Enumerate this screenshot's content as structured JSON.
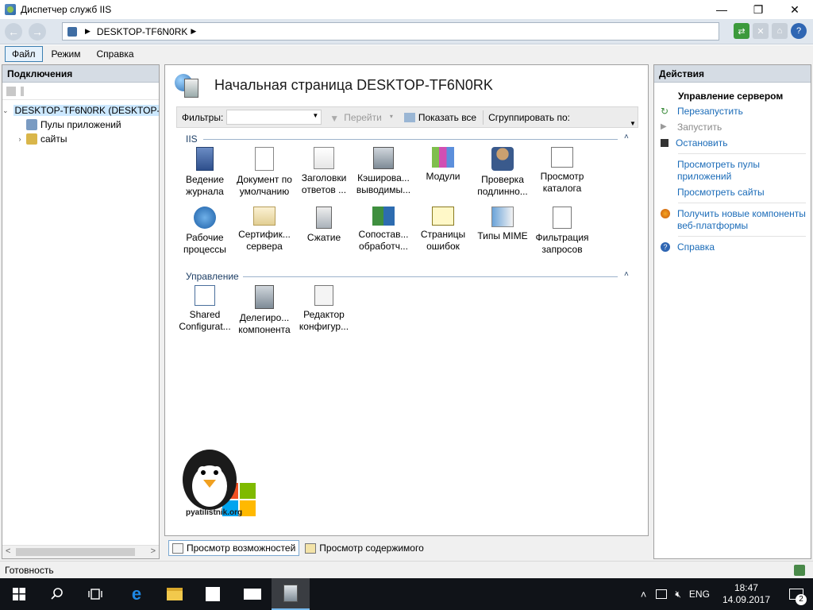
{
  "window": {
    "title": "Диспетчер служб IIS",
    "minimize": "—",
    "maximize": "❐",
    "close": "✕"
  },
  "address": {
    "back_glyph": "←",
    "forward_glyph": "→",
    "crumb_sep": "▶",
    "path": "DESKTOP-TF6N0RK",
    "path_arrow": "▶",
    "help_glyph": "?"
  },
  "menu": {
    "items": [
      "Файл",
      "Режим",
      "Справка"
    ]
  },
  "connections": {
    "header": "Подключения",
    "tree": [
      {
        "label": "DESKTOP-TF6N0RK (DESKTOP-TF6N0RK\\Admin)",
        "expander": "⌄",
        "level": 0,
        "icon": "server-icon"
      },
      {
        "label": "Пулы приложений",
        "expander": "",
        "level": 1,
        "icon": "app-pools-icon"
      },
      {
        "label": "сайты",
        "expander": "›",
        "level": 1,
        "icon": "sites-icon"
      }
    ],
    "scroll_left": "<",
    "scroll_right": ">"
  },
  "main": {
    "title": "Начальная страница DESKTOP-TF6N0RK",
    "filter_label": "Фильтры:",
    "go_label": "Перейти",
    "show_all_label": "Показать все",
    "group_by_label": "Сгруппировать по:",
    "sections": [
      {
        "title": "IIS",
        "features": [
          {
            "label": "Ведение журнала",
            "icon": "logging-icon"
          },
          {
            "label": "Документ по умолчанию",
            "icon": "default-document-icon"
          },
          {
            "label": "Заголовки ответов ...",
            "icon": "http-response-headers-icon"
          },
          {
            "label": "Кэширова... выводимы...",
            "icon": "output-caching-icon"
          },
          {
            "label": "Модули",
            "icon": "modules-icon"
          },
          {
            "label": "Проверка подлинно...",
            "icon": "authentication-icon"
          },
          {
            "label": "Просмотр каталога",
            "icon": "directory-browsing-icon"
          },
          {
            "label": "Рабочие процессы",
            "icon": "worker-processes-icon"
          },
          {
            "label": "Сертифик... сервера",
            "icon": "server-certificates-icon"
          },
          {
            "label": "Сжатие",
            "icon": "compression-icon"
          },
          {
            "label": "Сопостав... обработч...",
            "icon": "handler-mappings-icon"
          },
          {
            "label": "Страницы ошибок",
            "icon": "error-pages-icon"
          },
          {
            "label": "Типы MIME",
            "icon": "mime-types-icon"
          },
          {
            "label": "Фильтрация запросов",
            "icon": "request-filtering-icon"
          }
        ]
      },
      {
        "title": "Управление",
        "features": [
          {
            "label": "Shared Configurat...",
            "icon": "shared-configuration-icon"
          },
          {
            "label": "Делегиро... компонента",
            "icon": "feature-delegation-icon"
          },
          {
            "label": "Редактор конфигур...",
            "icon": "configuration-editor-icon"
          }
        ]
      }
    ],
    "collapse_glyph": "˄",
    "watermark_text": "pyatilistnik.org"
  },
  "bottom_tabs": [
    {
      "label": "Просмотр возможностей",
      "active": true
    },
    {
      "label": "Просмотр содержимого",
      "active": false
    }
  ],
  "actions": {
    "header": "Действия",
    "group_title": "Управление сервером",
    "items": [
      {
        "label": "Перезапустить",
        "icon": "restart-icon",
        "disabled": false
      },
      {
        "label": "Запустить",
        "icon": "start-icon",
        "disabled": true
      },
      {
        "label": "Остановить",
        "icon": "stop-icon",
        "disabled": false
      }
    ],
    "links": [
      {
        "label": "Просмотреть пулы приложений"
      },
      {
        "label": "Просмотреть сайты"
      }
    ],
    "web_platform": "Получить новые компоненты веб-платформы",
    "help": "Справка"
  },
  "status": {
    "text": "Готовность"
  },
  "taskbar": {
    "language": "ENG",
    "time": "18:47",
    "date": "14.09.2017",
    "notifications": "2"
  },
  "colors": {
    "link": "#1a6bb8",
    "header_bg": "#d5dce4",
    "taskbar_bg": "#101318"
  }
}
